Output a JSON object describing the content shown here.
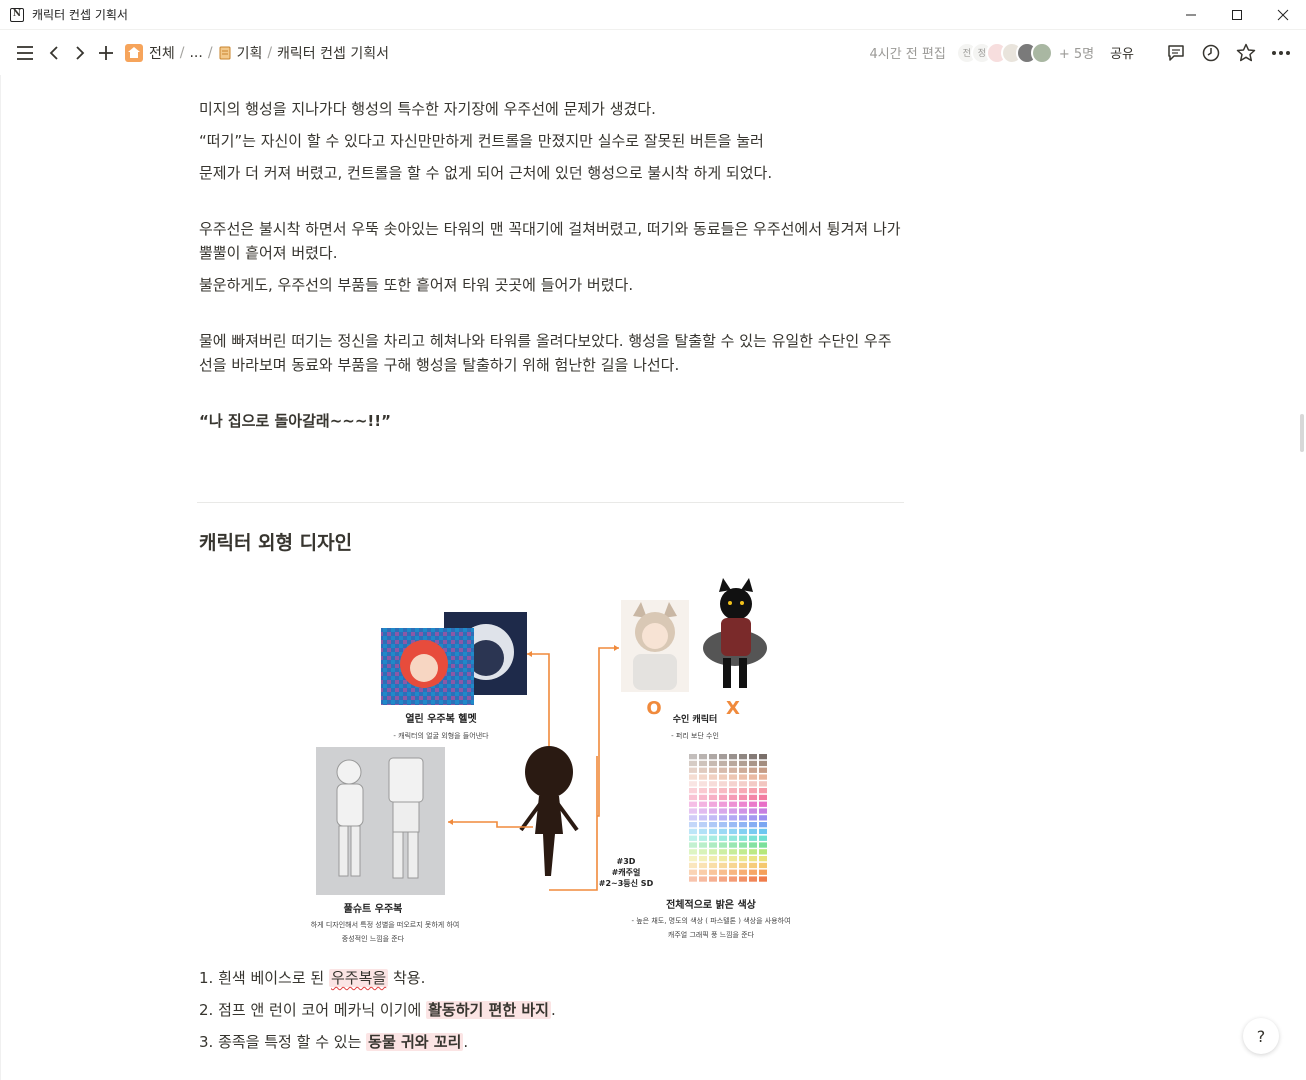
{
  "window": {
    "title": "캐릭터 컨셉 기획서",
    "app_icon": "N",
    "minimize_icon": "minimize-icon",
    "maximize_icon": "maximize-icon",
    "close_icon": "close-icon"
  },
  "breadcrumb": {
    "items": [
      "전체",
      "...",
      "기획",
      "캐릭터 컨셉 기획서"
    ]
  },
  "topbar": {
    "edited": "4시간 전 편집",
    "avatars": [
      "전",
      "정"
    ],
    "more_people": "+ 5명",
    "share": "공유"
  },
  "content": {
    "paragraphs": [
      "미지의 행성을 지나가다 행성의 특수한 자기장에 우주선에 문제가 생겼다.",
      "“떠기”는 자신이 할 수 있다고 자신만만하게 컨트롤을 만졌지만 실수로 잘못된 버튼을 눌러",
      "문제가 더 커져 버렸고, 컨트롤을 할 수 없게 되어 근처에 있던 행성으로 불시착 하게 되었다.",
      "우주선은 불시착 하면서 우뚝 솟아있는 타워의 맨 꼭대기에 걸쳐버렸고, 떠기와 동료들은 우주선에서 튕겨져 나가 뿔뿔이 흩어져 버렸다.",
      "불운하게도, 우주선의 부품들 또한 흩어져 타워 곳곳에 들어가 버렸다.",
      "물에 빠져버린 떠기는 정신을 차리고 헤쳐나와 타워를 올려다보았다. 행성을 탈출할 수 있는 유일한 수단인 우주선을 바라보며 동료와 부품을 구해 행성을 탈출하기 위해 험난한 길을 나선다.",
      "“나 집으로 돌아갈래~~~!!”"
    ],
    "heading": "캐릭터 외형 디자인",
    "figure": {
      "helmet_title": "열린 우주복 헬멧",
      "helmet_desc": "- 캐릭터의 얼굴 외형을 들어낸다",
      "suit_title": "풀슈트 우주복",
      "suit_desc_1": "-  펑퍼짐하게 디자인해서 특정 성별을 떠오르지 못하게 하여",
      "suit_desc_2": "중성적인 느낌을 준다",
      "ok_mark": "O",
      "no_mark": "X",
      "animal_title": "수인 캐릭터",
      "animal_desc": "- 퍼리 보단 수인",
      "tags": [
        "#3D",
        "#캐주얼",
        "#2~3등신 SD"
      ],
      "color_title": "전체적으로 밝은 색상",
      "color_desc_1": "-  높은 채도, 명도의 색상 ( 파스텔톤 ) 색상을 사용하여",
      "color_desc_2": "캐주얼 그래픽 풍 느낌을 준다"
    },
    "list": [
      {
        "num": "1.",
        "before": "흰색 베이스로 된 ",
        "hl": "우주복을",
        "after": " 착용."
      },
      {
        "num": "2.",
        "before": "점프 앤 런이 코어 메카닉 이기에 ",
        "hl": "활동하기 편한 바지",
        "after": "."
      },
      {
        "num": "3.",
        "before": "종족을 특정 할 수 있는 ",
        "hl": "동물 귀와 꼬리",
        "after": "."
      }
    ]
  },
  "help": "?",
  "colors": {
    "accent_orange": "#f08a3c",
    "highlight_bg": "#fbe4e4",
    "text": "#37352f",
    "muted": "#9b9a97",
    "spell_underline": "#e03e3e"
  }
}
